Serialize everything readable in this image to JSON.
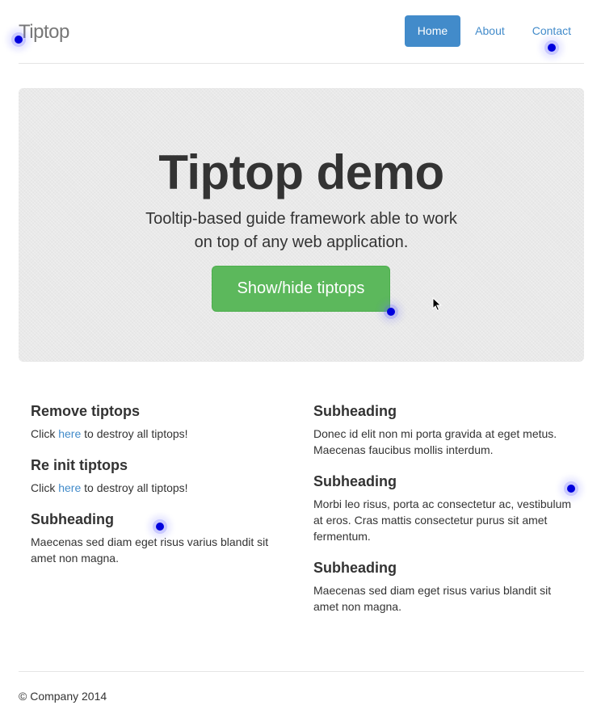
{
  "header": {
    "brand": "Tiptop",
    "nav": [
      {
        "label": "Home",
        "active": true
      },
      {
        "label": "About",
        "active": false
      },
      {
        "label": "Contact",
        "active": false
      }
    ]
  },
  "hero": {
    "title": "Tiptop demo",
    "tagline_line1": "Tooltip-based guide framework able to work",
    "tagline_line2": "on top of any web application.",
    "button_label": "Show/hide tiptops"
  },
  "left_column": {
    "remove": {
      "heading": "Remove tiptops",
      "prefix": "Click ",
      "link": "here",
      "suffix": " to destroy all tiptops!"
    },
    "reinit": {
      "heading": "Re init tiptops",
      "prefix": "Click ",
      "link": "here",
      "suffix": " to destroy all tiptops!"
    },
    "sub": {
      "heading": "Subheading",
      "text": "Maecenas sed diam eget risus varius blandit sit amet non magna."
    }
  },
  "right_column": [
    {
      "heading": "Subheading",
      "text": "Donec id elit non mi porta gravida at eget metus. Maecenas faucibus mollis interdum."
    },
    {
      "heading": "Subheading",
      "text": "Morbi leo risus, porta ac consectetur ac, vestibulum at eros. Cras mattis consectetur purus sit amet fermentum."
    },
    {
      "heading": "Subheading",
      "text": "Maecenas sed diam eget risus varius blandit sit amet non magna."
    }
  ],
  "footer": {
    "text": "© Company 2014"
  },
  "colors": {
    "brand_blue": "#428bca",
    "success_green": "#5cb85c",
    "tiptop_marker": "#0000dd"
  }
}
